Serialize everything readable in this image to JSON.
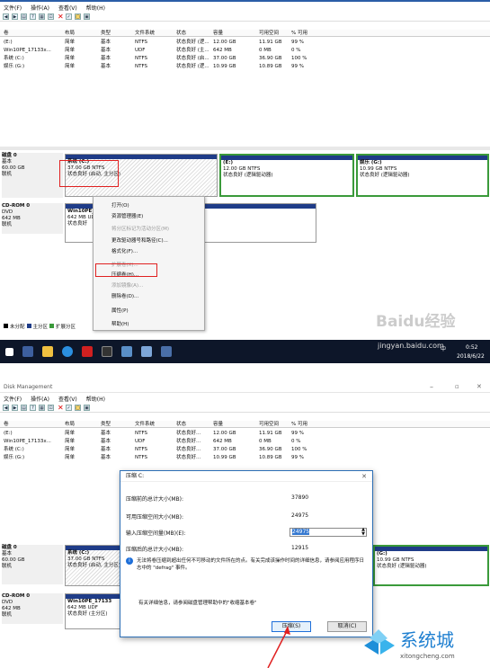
{
  "top": {
    "menu": [
      "文件(F)",
      "操作(A)",
      "查看(V)",
      "帮助(H)"
    ],
    "columns": [
      "卷",
      "布局",
      "类型",
      "文件系统",
      "状态",
      "容量",
      "可用空间",
      "% 可用"
    ],
    "volumes": [
      {
        "name": "(E:)",
        "layout": "简单",
        "type": "基本",
        "fs": "NTFS",
        "status": "状态良好 (逻...",
        "capacity": "12.00 GB",
        "free": "11.91 GB",
        "pct": "99 %"
      },
      {
        "name": "Win10PE_17133x...",
        "layout": "简单",
        "type": "基本",
        "fs": "UDF",
        "status": "状态良好 (主...",
        "capacity": "642 MB",
        "free": "0 MB",
        "pct": "0 %"
      },
      {
        "name": "系统 (C:)",
        "layout": "简单",
        "type": "基本",
        "fs": "NTFS",
        "status": "状态良好 (启...",
        "capacity": "37.00 GB",
        "free": "36.90 GB",
        "pct": "100 %"
      },
      {
        "name": "娱乐 (G:)",
        "layout": "简单",
        "type": "基本",
        "fs": "NTFS",
        "status": "状态良好 (逻...",
        "capacity": "10.99 GB",
        "free": "10.89 GB",
        "pct": "99 %"
      }
    ],
    "disk0": {
      "name": "磁盘 0",
      "type": "基本",
      "size": "60.00 GB",
      "state": "联机"
    },
    "cdrom": {
      "name": "CD-ROM 0",
      "type": "DVD",
      "size": "642 MB",
      "state": "联机"
    },
    "partC": {
      "name": "系统 (C:)",
      "size": "37.00 GB NTFS",
      "status": "状态良好 (启动, 主分区)"
    },
    "partE": {
      "name": "(E:)",
      "size": "12.00 GB NTFS",
      "status": "状态良好 (逻辑驱动器)"
    },
    "partG": {
      "name": "娱乐 (G:)",
      "size": "10.99 GB NTFS",
      "status": "状态良好 (逻辑驱动器)"
    },
    "partCD": {
      "name": "Win10PE_171",
      "size": "642 MB UDF",
      "status": "状态良好"
    },
    "context_menu": [
      {
        "label": "打开(O)",
        "enabled": true
      },
      {
        "label": "资源管理器(E)",
        "enabled": true
      },
      {
        "label": "将分区标记为活动分区(M)",
        "enabled": false
      },
      {
        "label": "更改驱动器号和路径(C)...",
        "enabled": true
      },
      {
        "label": "格式化(F)...",
        "enabled": true
      },
      {
        "label": "扩展卷(X)...",
        "enabled": false
      },
      {
        "label": "压缩卷(H)...",
        "enabled": true
      },
      {
        "label": "添加镜像(A)...",
        "enabled": false
      },
      {
        "label": "删除卷(D)...",
        "enabled": true
      },
      {
        "label": "属性(P)",
        "enabled": true
      },
      {
        "label": "帮助(H)",
        "enabled": true
      }
    ],
    "legend": [
      "未分配",
      "主分区",
      "扩展分区"
    ],
    "taskbar": {
      "time": "0:52",
      "date": "2018/6/22",
      "ime": "中",
      "watermark": "Baidu经验",
      "watermark_url": "jingyan.baidu.com"
    }
  },
  "bottom": {
    "window_title": "Disk Management",
    "menu": [
      "文件(F)",
      "操作(A)",
      "查看(V)",
      "帮助(H)"
    ],
    "columns": [
      "卷",
      "布局",
      "类型",
      "文件系统",
      "状态",
      "容量",
      "可用空间",
      "% 可用"
    ],
    "volumes": [
      {
        "name": "(E:)",
        "layout": "简单",
        "type": "基本",
        "fs": "NTFS",
        "status": "状态良好...",
        "capacity": "12.00 GB",
        "free": "11.91 GB",
        "pct": "99 %"
      },
      {
        "name": "Win10PE_17133x...",
        "layout": "简单",
        "type": "基本",
        "fs": "UDF",
        "status": "状态良好...",
        "capacity": "642 MB",
        "free": "0 MB",
        "pct": "0 %"
      },
      {
        "name": "系统 (C:)",
        "layout": "简单",
        "type": "基本",
        "fs": "NTFS",
        "status": "状态良好...",
        "capacity": "37.00 GB",
        "free": "36.90 GB",
        "pct": "100 %"
      },
      {
        "name": "娱乐 (G:)",
        "layout": "简单",
        "type": "基本",
        "fs": "NTFS",
        "status": "状态良好...",
        "capacity": "10.99 GB",
        "free": "10.89 GB",
        "pct": "99 %"
      }
    ],
    "disk0": {
      "name": "磁盘 0",
      "type": "基本",
      "size": "60.00 GB",
      "state": "联机"
    },
    "cdrom": {
      "name": "CD-ROM 0",
      "type": "DVD",
      "size": "642 MB",
      "state": "联机"
    },
    "partC": {
      "name": "系统 (C:)",
      "size": "37.00 GB NTFS",
      "status": "状态良好 (启动, 主分区)"
    },
    "partG": {
      "name": "(G:)",
      "size": "10.99 GB NTFS",
      "status": "状态良好 (逻辑驱动器)"
    },
    "partCD": {
      "name": "Win10PE_17133",
      "size": "642 MB UDF",
      "status": "状态良好 (主分区)"
    },
    "dialog": {
      "title": "压缩 C:",
      "total_label": "压缩前的总计大小(MB):",
      "total_value": "37890",
      "avail_label": "可用压缩空间大小(MB):",
      "avail_value": "24975",
      "input_label": "输入压缩空间量(MB)(E):",
      "input_value": "24975",
      "after_label": "压缩后的总计大小(MB):",
      "after_value": "12915",
      "info": "无法将卷压缩到超出任何不可移动的文件所在的点。有关完成该操作时间的详细信息，请参阅应用程序日志中的 \"defrag\" 事件。",
      "more": "有关详细信息，请参阅磁盘管理帮助中的\"收缩基本卷\"",
      "ok": "压缩(S)",
      "cancel": "取消(C)"
    },
    "brand": "系统城",
    "brand_url": "xitongcheng.com"
  }
}
